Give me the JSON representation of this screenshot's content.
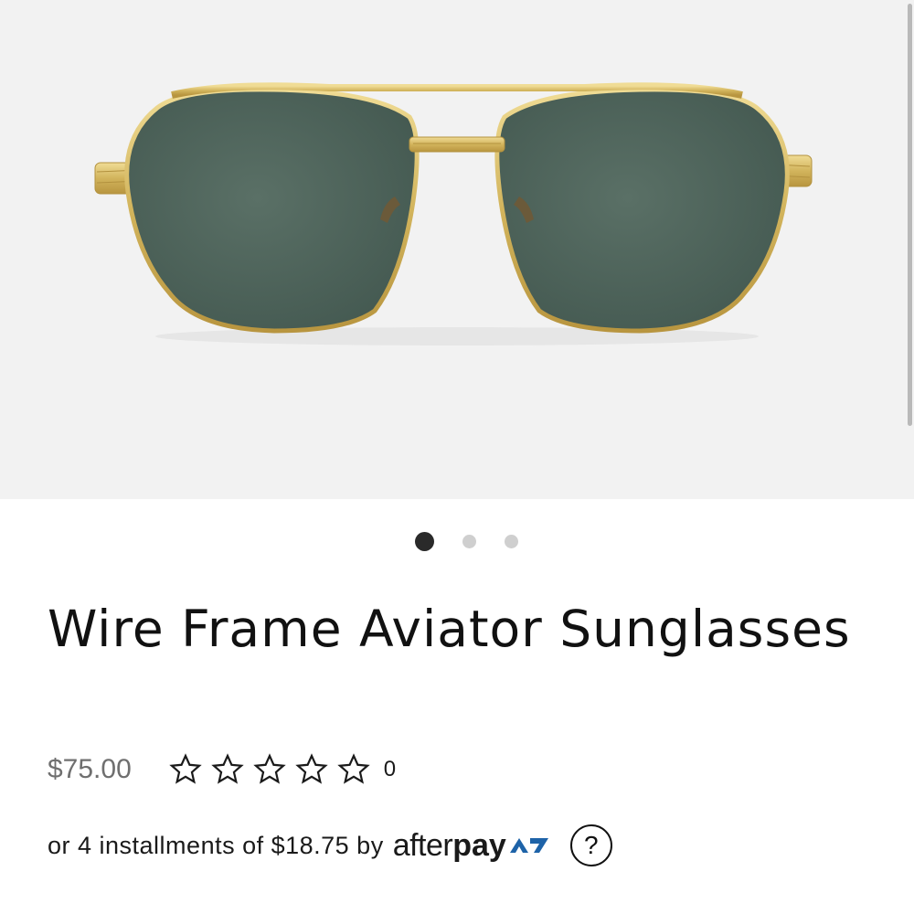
{
  "product": {
    "title": "Wire Frame Aviator Sunglasses",
    "price": "$75.00",
    "rating": {
      "stars_filled": 0,
      "stars_total": 5,
      "review_count": "0"
    },
    "image_carousel": {
      "total": 3,
      "active_index": 0
    }
  },
  "installments": {
    "text": "or 4 installments of $18.75 by",
    "logo_light": "after",
    "logo_bold": "pay",
    "help_label": "?"
  },
  "colors": {
    "image_background": "#f2f2f2",
    "frame_gold": "#d2b45c",
    "lens_green": "#4e655c",
    "temple_tortoise": "#6b2a18",
    "afterpay_mark": "#1e63a8",
    "dot_active": "#2a2a2a",
    "dot_inactive": "#cfcfcf"
  },
  "icons": {
    "star": "star-outline-icon",
    "help": "question-circle-icon",
    "afterpay": "afterpay-arrows-icon"
  }
}
